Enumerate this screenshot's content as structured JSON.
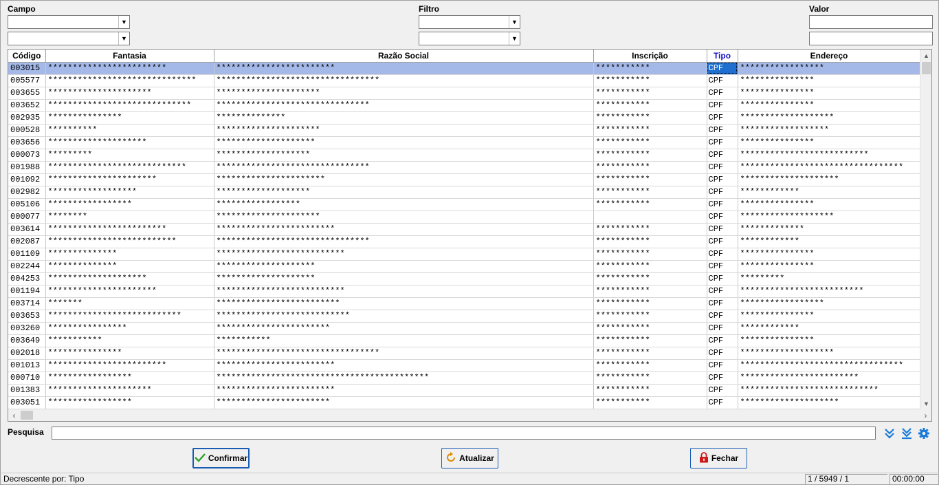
{
  "filters": {
    "campo_label": "Campo",
    "filtro_label": "Filtro",
    "valor_label": "Valor"
  },
  "grid": {
    "columns": [
      "Código",
      "Fantasia",
      "Razão Social",
      "Inscrição",
      "Tipo",
      "Endereço"
    ],
    "sorted_column": "Tipo",
    "rows": [
      [
        "003015",
        "************************",
        "************************",
        "***********",
        "CPF",
        "*****************"
      ],
      [
        "005577",
        "******************************",
        "*********************************",
        "***********",
        "CPF",
        "***************"
      ],
      [
        "003655",
        "*********************",
        "*********************",
        "***********",
        "CPF",
        "***************"
      ],
      [
        "003652",
        "*****************************",
        "*******************************",
        "***********",
        "CPF",
        "***************"
      ],
      [
        "002935",
        "***************",
        "**************",
        "***********",
        "CPF",
        "*******************"
      ],
      [
        "000528",
        "**********",
        "*********************",
        "***********",
        "CPF",
        "******************"
      ],
      [
        "003656",
        "********************",
        "********************",
        "***********",
        "CPF",
        "***************"
      ],
      [
        "000073",
        "*********",
        "*******************",
        "***********",
        "CPF",
        "**************************"
      ],
      [
        "001988",
        "****************************",
        "*******************************",
        "***********",
        "CPF",
        "*********************************"
      ],
      [
        "001092",
        "**********************",
        "**********************",
        "***********",
        "CPF",
        "********************"
      ],
      [
        "002982",
        "******************",
        "*******************",
        "***********",
        "CPF",
        "************"
      ],
      [
        "005106",
        "*****************",
        "*****************",
        "***********",
        "CPF",
        "***************"
      ],
      [
        "000077",
        "********",
        "*********************",
        "",
        "CPF",
        "*******************"
      ],
      [
        "003614",
        "************************",
        "************************",
        "***********",
        "CPF",
        "*************"
      ],
      [
        "002087",
        "**************************",
        "*******************************",
        "***********",
        "CPF",
        "************"
      ],
      [
        "001109",
        "**************",
        "**************************",
        "***********",
        "CPF",
        "***************"
      ],
      [
        "002244",
        "**************",
        "********************",
        "***********",
        "CPF",
        "***************"
      ],
      [
        "004253",
        "********************",
        "********************",
        "***********",
        "CPF",
        "*********"
      ],
      [
        "001194",
        "**********************",
        "**************************",
        "***********",
        "CPF",
        "*************************"
      ],
      [
        "003714",
        "*******",
        "*************************",
        "***********",
        "CPF",
        "*****************"
      ],
      [
        "003653",
        "***************************",
        "***************************",
        "***********",
        "CPF",
        "***************"
      ],
      [
        "003260",
        "****************",
        "***********************",
        "***********",
        "CPF",
        "************"
      ],
      [
        "003649",
        "***********",
        "***********",
        "***********",
        "CPF",
        "***************"
      ],
      [
        "002018",
        "***************",
        "*********************************",
        "***********",
        "CPF",
        "*******************"
      ],
      [
        "001013",
        "************************",
        "************************",
        "***********",
        "CPF",
        "*********************************"
      ],
      [
        "000710",
        "*****************",
        "*******************************************",
        "***********",
        "CPF",
        "************************"
      ],
      [
        "001383",
        "*********************",
        "************************",
        "***********",
        "CPF",
        "****************************"
      ],
      [
        "003051",
        "*****************",
        "***********************",
        "***********",
        "CPF",
        "********************"
      ]
    ]
  },
  "search": {
    "label": "Pesquisa",
    "value": ""
  },
  "buttons": {
    "confirm": "Confirmar",
    "refresh": "Atualizar",
    "close": "Fechar"
  },
  "status": {
    "sort_text": "Decrescente por: Tipo",
    "record_counter": "1 / 5949 / 1",
    "timer": "00:00:00"
  },
  "colors": {
    "accent": "#1a5bb4",
    "selected_row": "#a4b9e8",
    "selected_cell": "#1e6fd0",
    "sorted_header": "#1010c8"
  },
  "icons": {
    "expand": "double-chevron-down-icon",
    "last": "chevron-down-to-bottom-icon",
    "settings": "gear-icon",
    "confirm": "checkmark-icon",
    "refresh": "refresh-icon",
    "close": "lock-icon"
  }
}
